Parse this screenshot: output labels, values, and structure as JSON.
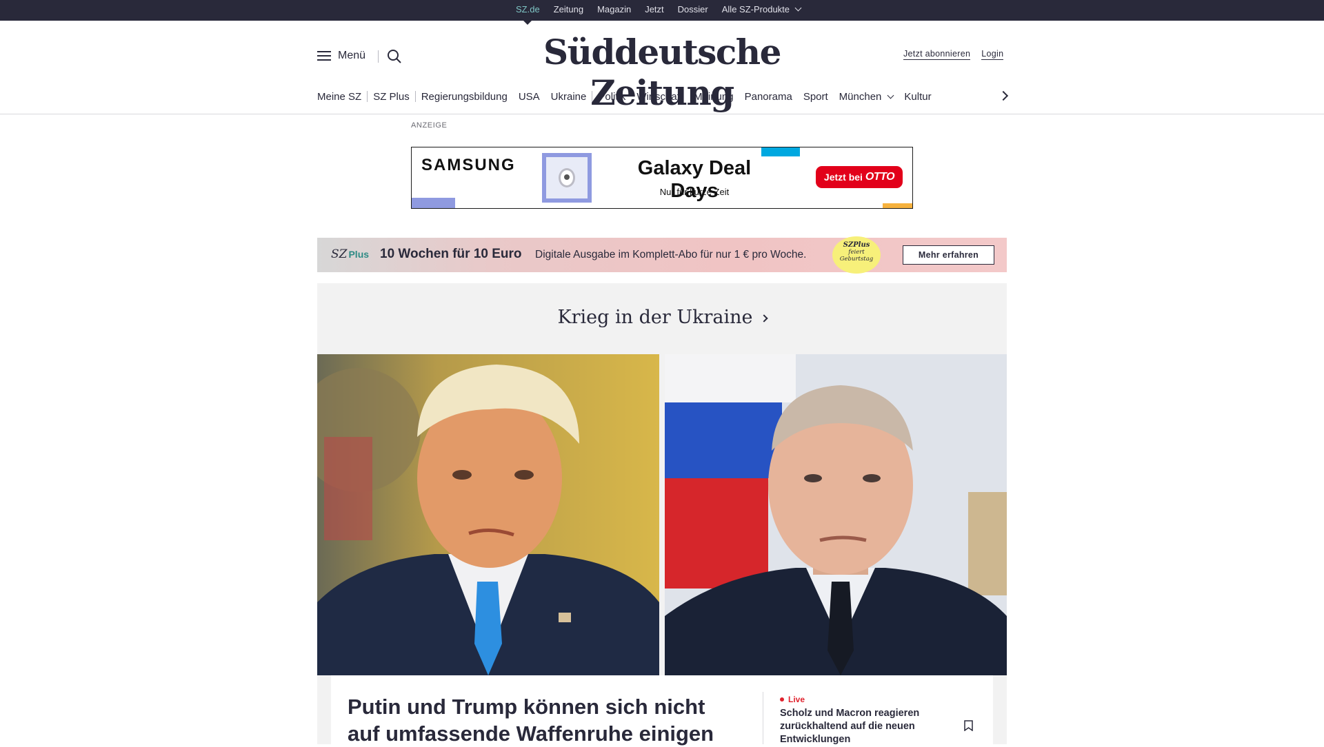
{
  "topbar": {
    "items": [
      {
        "label": "SZ.de",
        "active": true
      },
      {
        "label": "Zeitung"
      },
      {
        "label": "Magazin"
      },
      {
        "label": "Jetzt"
      },
      {
        "label": "Dossier"
      },
      {
        "label": "Alle SZ-Produkte"
      }
    ]
  },
  "header": {
    "menu_label": "Menü",
    "logo": "Süddeutsche Zeitung",
    "subscribe_label": "Jetzt abonnieren",
    "login_label": "Login"
  },
  "nav": {
    "items": [
      "Meine SZ",
      "SZ Plus",
      "Regierungsbildung",
      "USA",
      "Ukraine",
      "Politik",
      "Wirtschaft",
      "Meinung",
      "Panorama",
      "Sport",
      "München",
      "Kultur"
    ]
  },
  "ad": {
    "label": "ANZEIGE",
    "brand": "SAMSUNG",
    "title": "Galaxy Deal Days",
    "subtitle": "Nur für kurze Zeit",
    "cta_prefix": "Jetzt bei",
    "cta_brand": "OTTO"
  },
  "promo": {
    "logo_sz": "SZ",
    "logo_plus": "Plus",
    "headline": "10 Wochen für 10 Euro",
    "text": "Digitale Ausgabe im Komplett-Abo für nur 1 € pro Woche.",
    "badge_line1": "SZPlus",
    "badge_line2": "feiert",
    "badge_line3": "Geburtstag",
    "button_label": "Mehr erfahren"
  },
  "section": {
    "title": "Krieg in der Ukraine"
  },
  "lead_article": {
    "title": "Putin und Trump können sich nicht auf umfassende Waffenruhe einigen"
  },
  "side_article": {
    "badge": "Live",
    "title": "Scholz und Macron reagieren zurückhaltend auf die neuen Entwicklungen"
  },
  "colors": {
    "topbar_bg": "#29293a",
    "active_link": "#7fc5c5",
    "live_red": "#e0232e",
    "otto_red": "#e2001a"
  }
}
